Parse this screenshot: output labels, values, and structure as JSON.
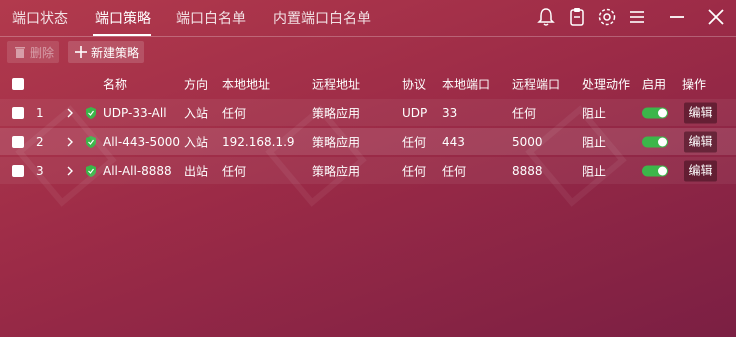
{
  "tabs": [
    {
      "label": "端口状态"
    },
    {
      "label": "端口策略"
    },
    {
      "label": "端口白名单"
    },
    {
      "label": "内置端口白名单"
    }
  ],
  "toolbar": {
    "delete_label": "删除",
    "new_label": "新建策略"
  },
  "table": {
    "headers": {
      "name": "名称",
      "direction": "方向",
      "local_addr": "本地地址",
      "remote_addr": "远程地址",
      "protocol": "协议",
      "local_port": "本地端口",
      "remote_port": "远程端口",
      "action": "处理动作",
      "enabled": "启用",
      "ops": "操作"
    },
    "rows": [
      {
        "index": "1",
        "name": "UDP-33-All",
        "direction": "入站",
        "local_addr": "任何",
        "remote_addr": "策略应用",
        "protocol": "UDP",
        "local_port": "33",
        "remote_port": "任何",
        "action": "阻止",
        "enabled": true,
        "edit_label": "编辑"
      },
      {
        "index": "2",
        "name": "All-443-5000",
        "direction": "入站",
        "local_addr": "192.168.1.9",
        "remote_addr": "策略应用",
        "protocol": "任何",
        "local_port": "443",
        "remote_port": "5000",
        "action": "阻止",
        "enabled": true,
        "edit_label": "编辑"
      },
      {
        "index": "3",
        "name": "All-All-8888",
        "direction": "出站",
        "local_addr": "任何",
        "remote_addr": "策略应用",
        "protocol": "任何",
        "local_port": "任何",
        "remote_port": "8888",
        "action": "阻止",
        "enabled": true,
        "edit_label": "编辑"
      }
    ]
  },
  "colors": {
    "toggle_on": "#3cb64a",
    "shield": "#3cb64a"
  },
  "icons": [
    "bell-icon",
    "clipboard-icon",
    "gear-icon",
    "menu-icon",
    "minimize-icon",
    "close-icon"
  ]
}
